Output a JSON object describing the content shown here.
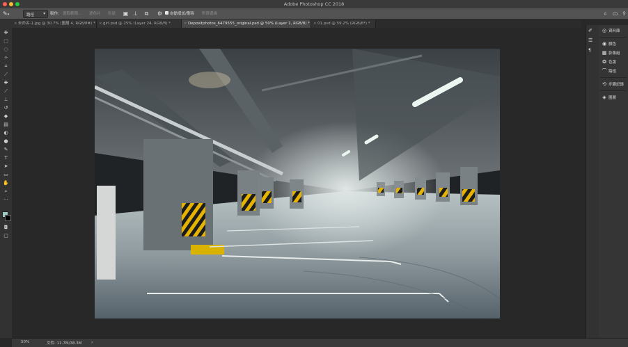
{
  "window": {
    "title": "Adobe Photoshop CC 2018",
    "traffic_lights": {
      "close": "#ff5f57",
      "minimize": "#febc2e",
      "zoom": "#28c840"
    }
  },
  "options_bar": {
    "tool_preset_icon": "pen-icon",
    "mode_select_value": "路徑",
    "make_label": "製作:",
    "selection_btn": "選取範圍...",
    "mask_btn": "遮色片",
    "shape_btn": "形狀",
    "auto_add_delete_label": "自動增加/刪除",
    "align_edges_label": "對齊邊緣"
  },
  "tabs": [
    {
      "label": "未命名-1.jpg @ 30.7% (圖層 4, RGB/8#) *",
      "active": false
    },
    {
      "label": "girl.psd @ 25% (Layer 24, RGB/8) *",
      "active": false
    },
    {
      "label": "Depositphotos_6479555_original.psd @ 50% (Layer 1, RGB/8) *",
      "active": true
    },
    {
      "label": "01.psd @ 59.2% (RGB/8*) *",
      "active": false
    }
  ],
  "right_panels": {
    "history_group": [
      "資料庫"
    ],
    "color_group": [
      "顏色",
      "影像組",
      "色版",
      "路徑"
    ],
    "history_panel": [
      "步驟記錄"
    ],
    "layers_panel": [
      "圖層"
    ]
  },
  "status": {
    "zoom": "50%",
    "doc_info": "文件: 11.7M/38.3M"
  }
}
